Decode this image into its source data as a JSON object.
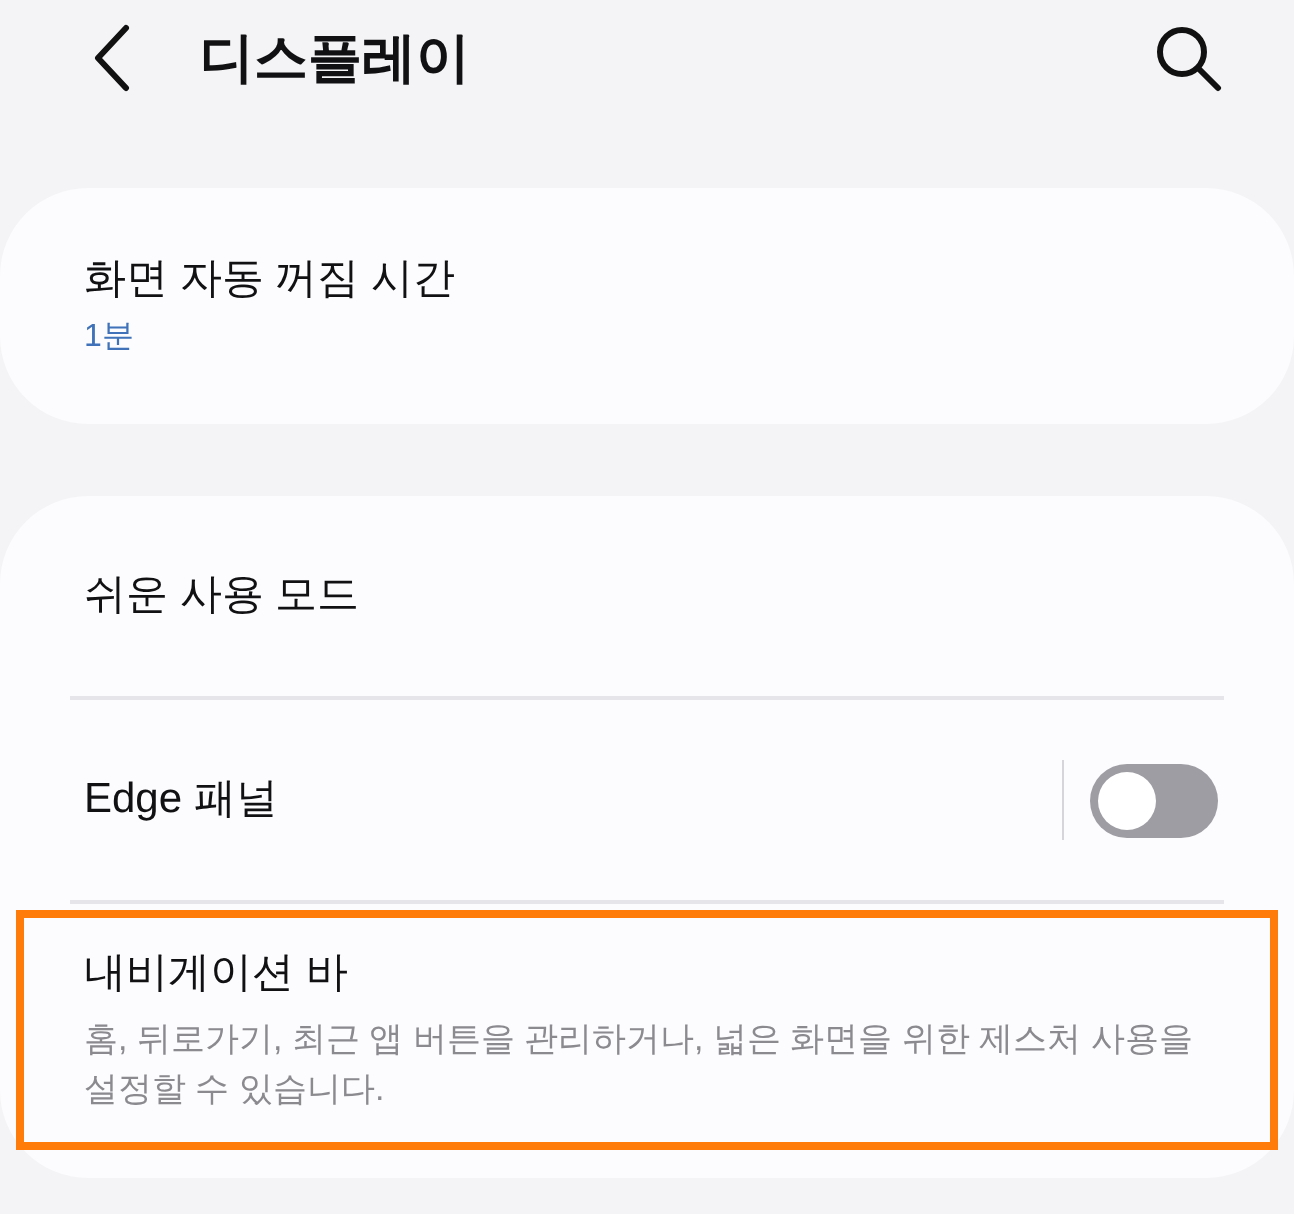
{
  "header": {
    "title": "디스플레이"
  },
  "groups": [
    {
      "items": [
        {
          "kind": "value",
          "title": "화면 자동 꺼짐 시간",
          "value": "1분",
          "highlighted": false
        }
      ]
    },
    {
      "items": [
        {
          "kind": "plain",
          "title": "쉬운 사용 모드",
          "highlighted": false
        },
        {
          "kind": "switch",
          "title": "Edge 패널",
          "on": false,
          "highlighted": false
        },
        {
          "kind": "description",
          "title": "내비게이션 바",
          "description": "홈, 뒤로가기, 최근 앱 버튼을 관리하거나, 넓은 화면을 위한 제스처 사용을 설정할 수 있습니다.",
          "highlighted": true
        }
      ]
    }
  ]
}
